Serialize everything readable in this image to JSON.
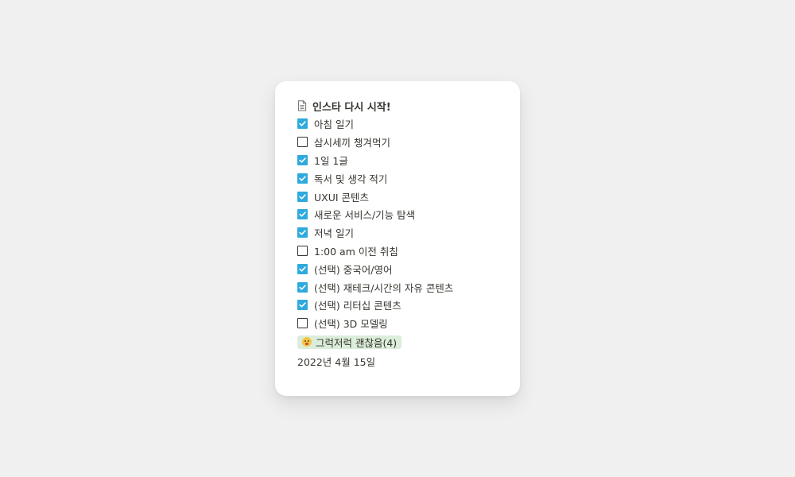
{
  "card": {
    "title": "인스타 다시 시작!",
    "title_icon": "document-icon",
    "items": [
      {
        "label": "아침 일기",
        "checked": true
      },
      {
        "label": "삼시세끼 챙겨먹기",
        "checked": false
      },
      {
        "label": "1일 1글",
        "checked": true
      },
      {
        "label": "독서 및 생각 적기",
        "checked": true
      },
      {
        "label": "UXUI 콘텐츠",
        "checked": true
      },
      {
        "label": "새로운 서비스/기능 탐색",
        "checked": true
      },
      {
        "label": "저녁 일기",
        "checked": true
      },
      {
        "label": "1:00 am 이전 취침",
        "checked": false
      },
      {
        "label": "(선택) 중국어/영어",
        "checked": true
      },
      {
        "label": "(선택) 재테크/시간의 자유 콘텐츠",
        "checked": true
      },
      {
        "label": "(선택) 리터십 콘텐츠",
        "checked": true
      },
      {
        "label": "(선택) 3D 모델링",
        "checked": false
      }
    ],
    "tag": {
      "label": "그럭저럭 괜찮음(4)",
      "icon": "hushed-face-emoji-icon",
      "color": "#dbeddb"
    },
    "date": "2022년 4월 15일"
  },
  "colors": {
    "checkbox_checked": "#2eaadc",
    "text": "#37352f",
    "background": "#f0f0f0"
  }
}
